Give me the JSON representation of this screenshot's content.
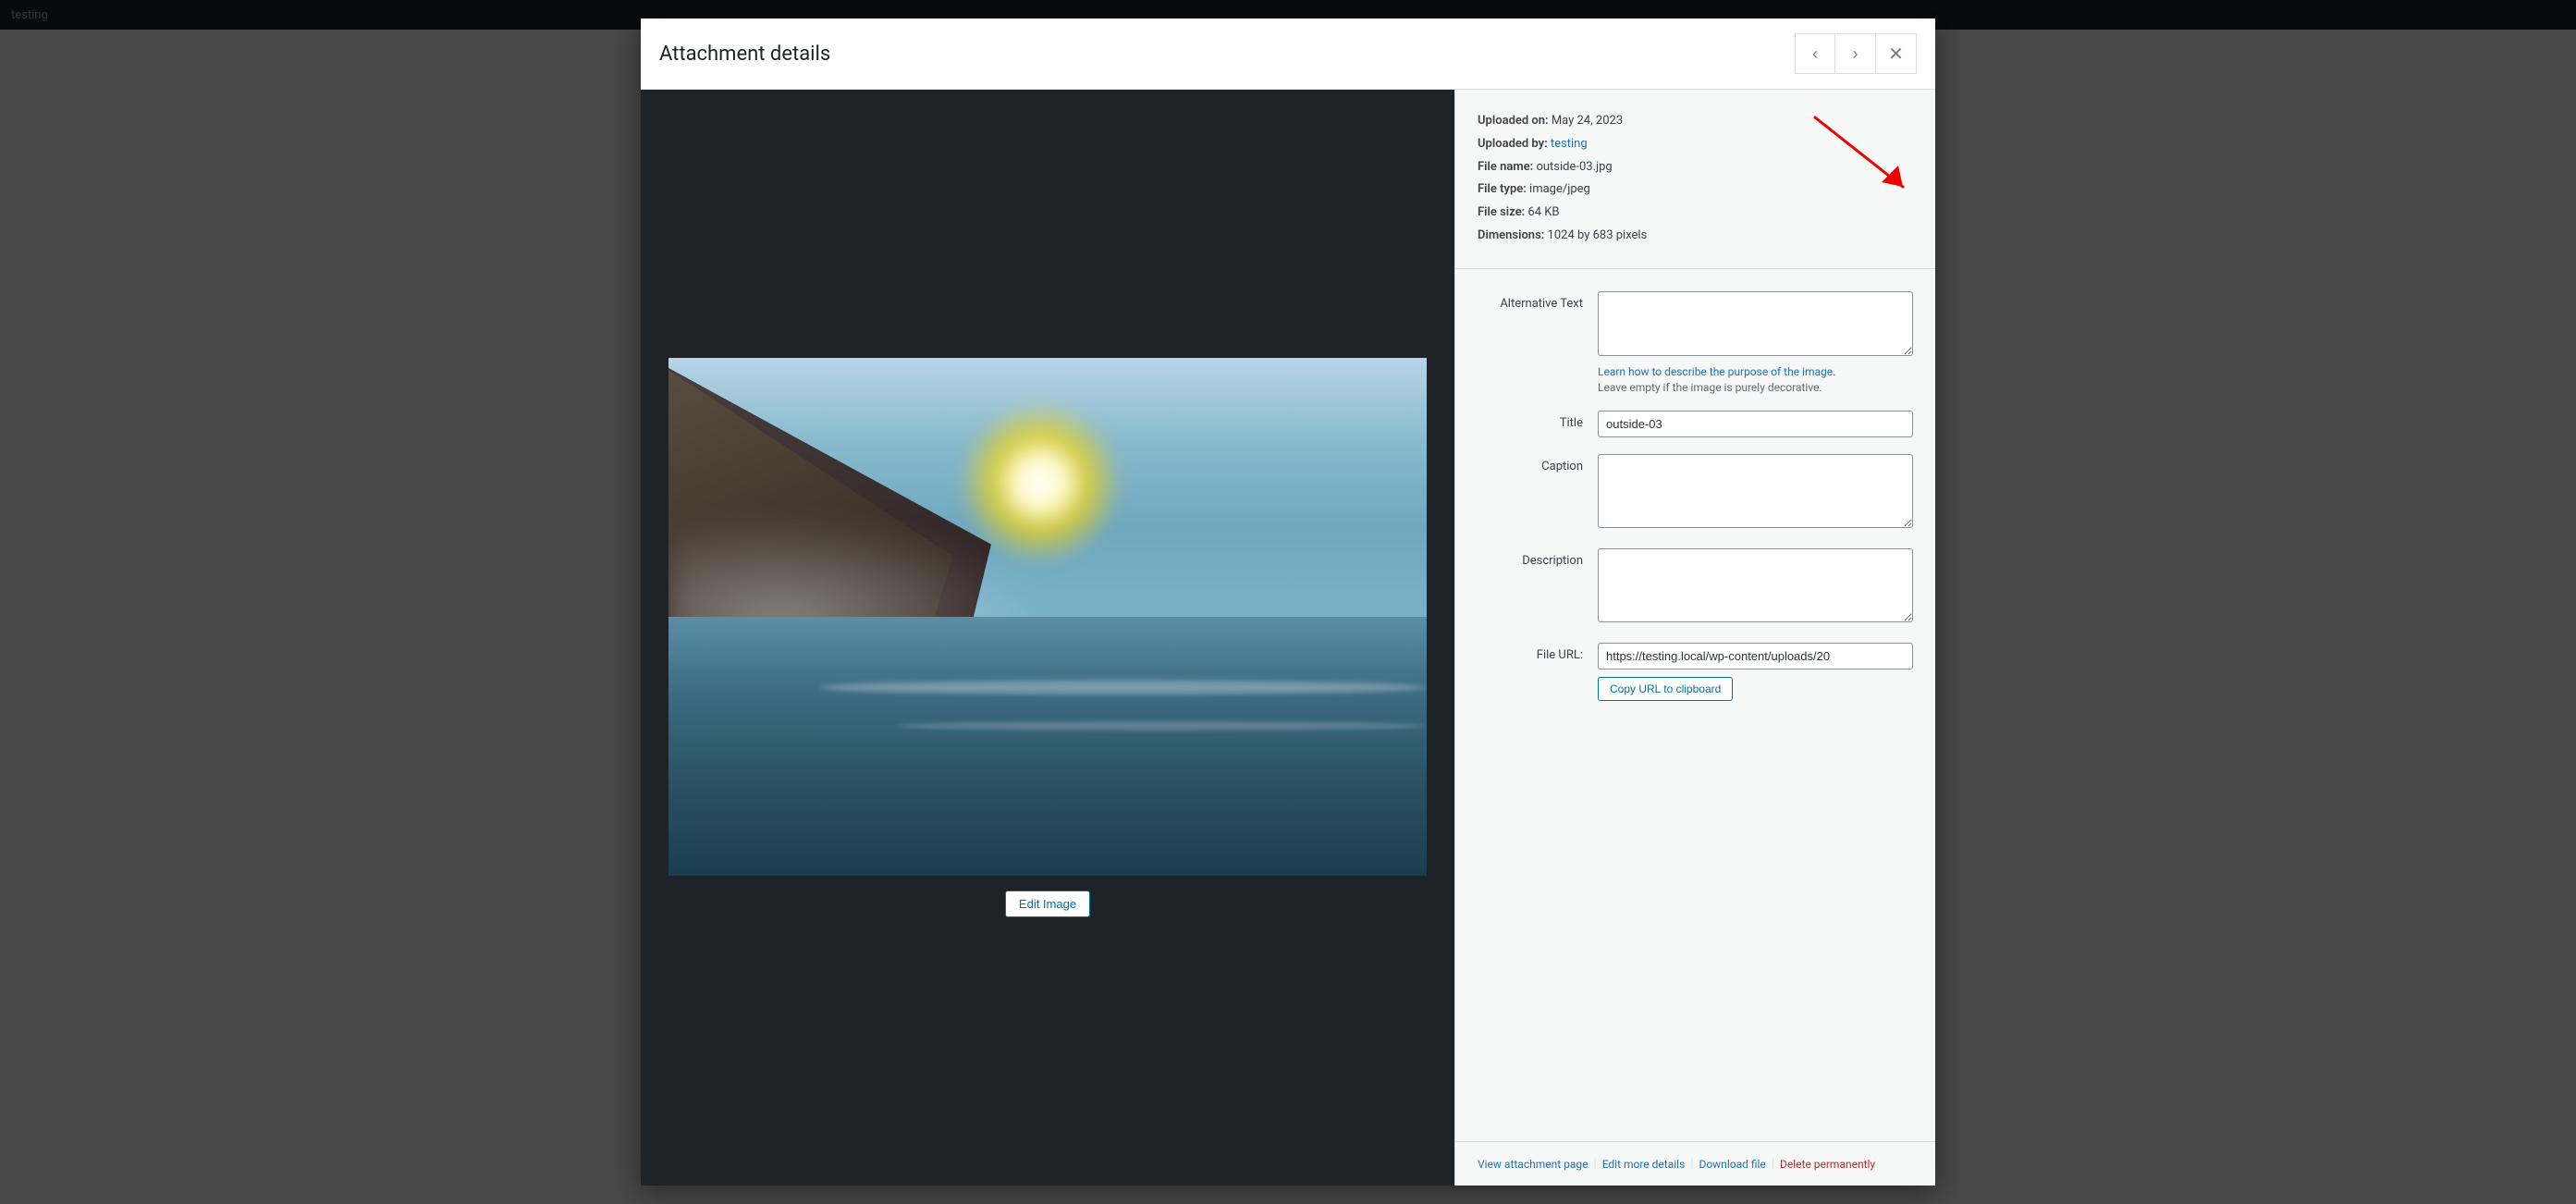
{
  "topbar": {
    "text": "testing"
  },
  "modal": {
    "title": "Attachment details"
  },
  "nav": {
    "prev_label": "‹",
    "next_label": "›",
    "close_label": "✕"
  },
  "fileInfo": {
    "uploaded_on_label": "Uploaded on:",
    "uploaded_on_value": "May 24, 2023",
    "uploaded_by_label": "Uploaded by:",
    "uploaded_by_value": "testing",
    "file_name_label": "File name:",
    "file_name_value": "outside-03.jpg",
    "file_type_label": "File type:",
    "file_type_value": "image/jpeg",
    "file_size_label": "File size:",
    "file_size_value": "64 KB",
    "dimensions_label": "Dimensions:",
    "dimensions_value": "1024 by 683 pixels"
  },
  "form": {
    "alt_text_label": "Alternative Text",
    "alt_text_value": "",
    "alt_text_placeholder": "",
    "alt_text_help_link": "Learn how to describe the purpose of the image.",
    "alt_text_hint": "Leave empty if the image is purely decorative.",
    "title_label": "Title",
    "title_value": "outside-03",
    "caption_label": "Caption",
    "caption_value": "",
    "description_label": "Description",
    "description_value": "",
    "file_url_label": "File URL:",
    "file_url_value": "https://testing.local/wp-content/uploads/20",
    "copy_url_btn": "Copy URL to clipboard"
  },
  "actions": {
    "view_attachment": "View attachment page",
    "edit_details": "Edit more details",
    "download_file": "Download file",
    "delete_permanently": "Delete permanently"
  },
  "editImage": {
    "label": "Edit Image"
  }
}
